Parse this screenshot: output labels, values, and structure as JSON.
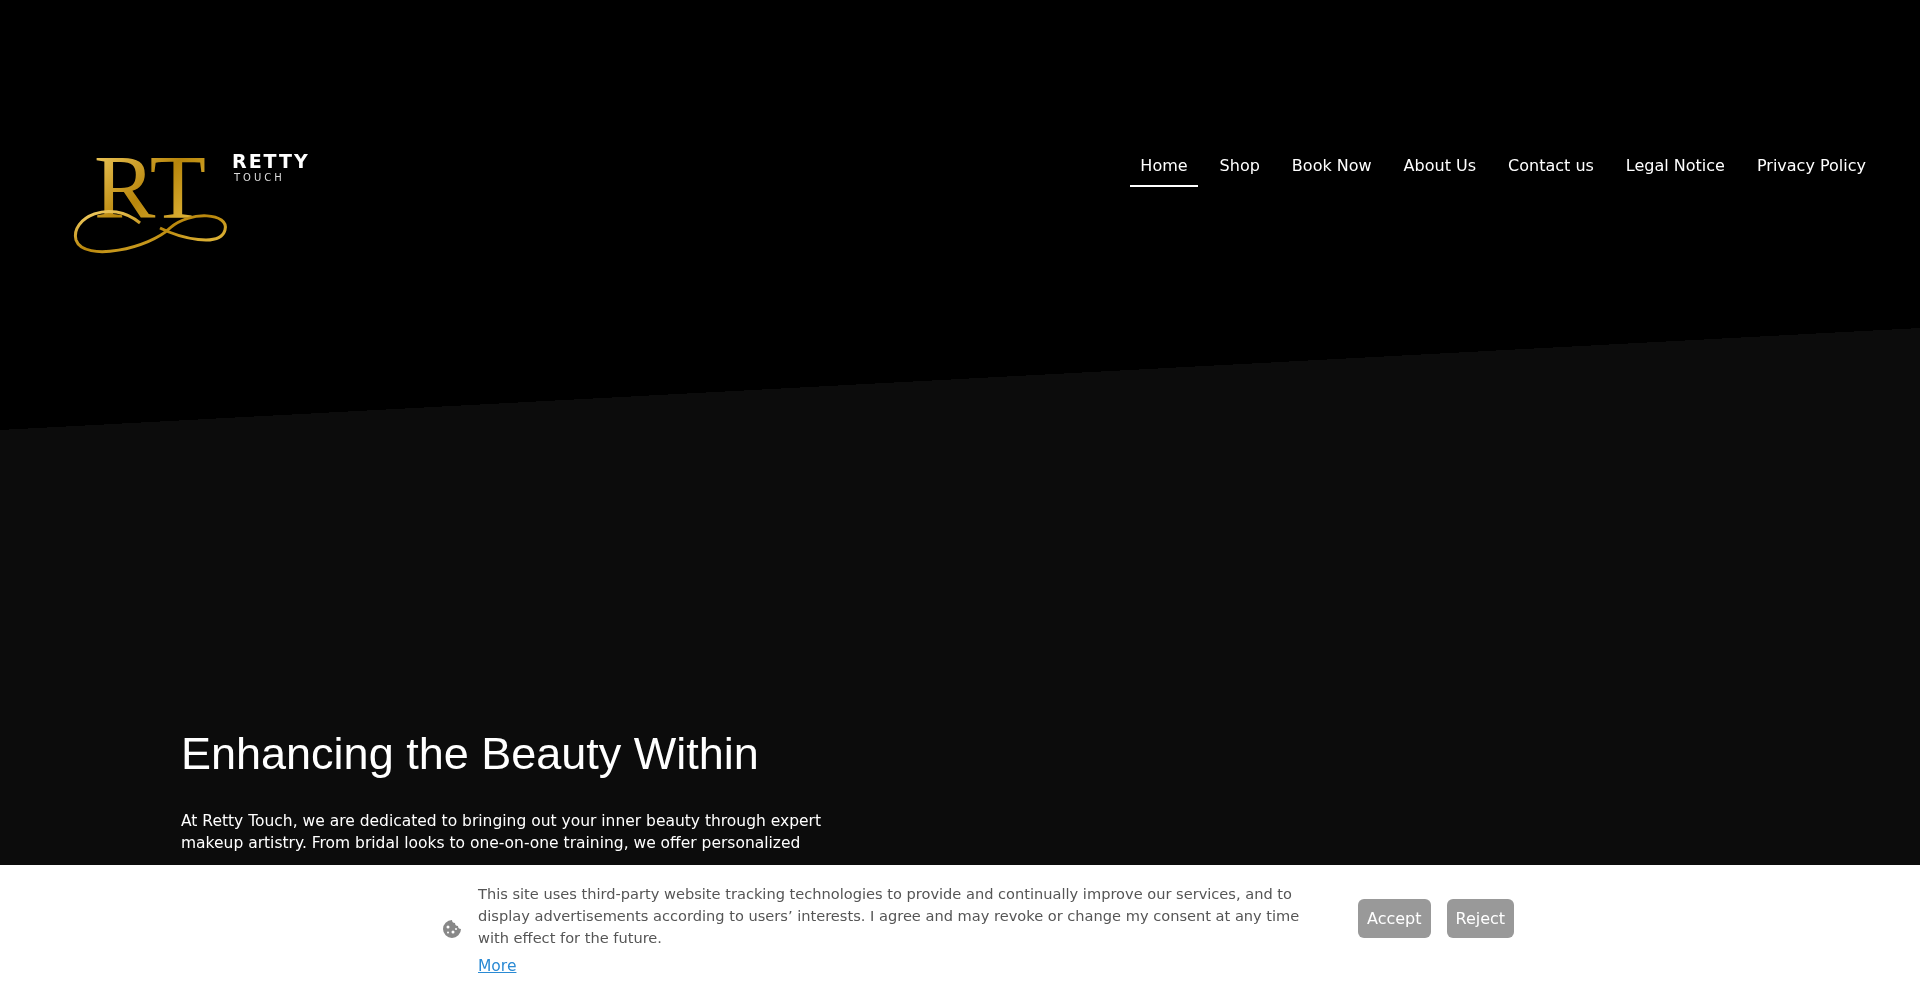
{
  "logo": {
    "monogram": "RT",
    "name": "RETTY",
    "tagline": "TOUCH"
  },
  "nav": [
    {
      "label": "Home",
      "selected": true
    },
    {
      "label": "Shop",
      "selected": false
    },
    {
      "label": "Book Now",
      "selected": false
    },
    {
      "label": "About Us",
      "selected": false
    },
    {
      "label": "Contact us",
      "selected": false
    },
    {
      "label": "Legal Notice",
      "selected": false
    },
    {
      "label": "Privacy Policy",
      "selected": false
    }
  ],
  "hero": {
    "heading": "Enhancing the Beauty Within",
    "text": "At Retty Touch, we are dedicated to bringing out your inner beauty through expert makeup artistry. From bridal looks to one-on-one training, we offer personalized"
  },
  "cookie_banner": {
    "text": "This site uses third-party website tracking technologies to provide and continually improve our services, and to display advertisements according to users’ interests. I agree and may revoke or change my consent at any time with effect for the future.",
    "link": "More",
    "buttons": [
      "Accept",
      "Reject"
    ]
  }
}
